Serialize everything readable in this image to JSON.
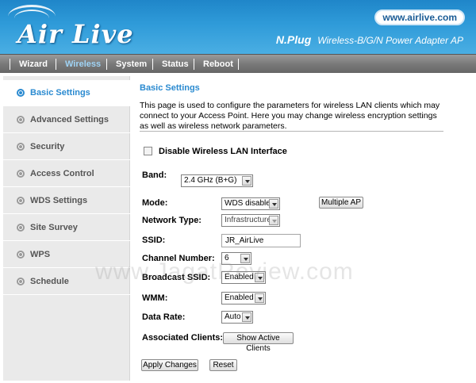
{
  "header": {
    "logo_text": "Air Live",
    "url": "www.airlive.com",
    "product_name": "N.Plug",
    "product_desc": "Wireless-B/G/N Power Adapter AP"
  },
  "nav": {
    "items": [
      "Wizard",
      "Wireless",
      "System",
      "Status",
      "Reboot"
    ],
    "active": "Wireless"
  },
  "sidebar": {
    "items": [
      {
        "label": "Basic Settings",
        "active": true
      },
      {
        "label": "Advanced Settings",
        "active": false
      },
      {
        "label": "Security",
        "active": false
      },
      {
        "label": "Access Control",
        "active": false
      },
      {
        "label": "WDS Settings",
        "active": false
      },
      {
        "label": "Site Survey",
        "active": false
      },
      {
        "label": "WPS",
        "active": false
      },
      {
        "label": "Schedule",
        "active": false
      }
    ]
  },
  "main": {
    "title": "Basic Settings",
    "description": "This page is used to configure the parameters for wireless LAN clients which may connect to your Access Point. Here you may change wireless encryption settings as well as wireless network parameters.",
    "disable_wlan_label": "Disable Wireless LAN Interface",
    "disable_wlan_checked": false,
    "band": {
      "label": "Band:",
      "value": "2.4 GHz (B+G)"
    },
    "mode": {
      "label": "Mode:",
      "value": "WDS disable"
    },
    "multiple_ap_button": "Multiple AP",
    "network_type": {
      "label": "Network Type:",
      "value": "Infrastructure"
    },
    "ssid": {
      "label": "SSID:",
      "value": "JR_AirLive"
    },
    "channel": {
      "label": "Channel Number:",
      "value": "6"
    },
    "broadcast_ssid": {
      "label": "Broadcast SSID:",
      "value": "Enabled"
    },
    "wmm": {
      "label": "WMM:",
      "value": "Enabled"
    },
    "data_rate": {
      "label": "Data Rate:",
      "value": "Auto"
    },
    "associated_clients": {
      "label": "Associated Clients:",
      "button": "Show Active Clients"
    },
    "apply_button": "Apply Changes",
    "reset_button": "Reset"
  },
  "watermark": "www.JagatReview.com",
  "colors": {
    "header_blue": "#2f9bd9",
    "active_link": "#2a8ad0",
    "nav_gray": "#7a7a7a"
  }
}
